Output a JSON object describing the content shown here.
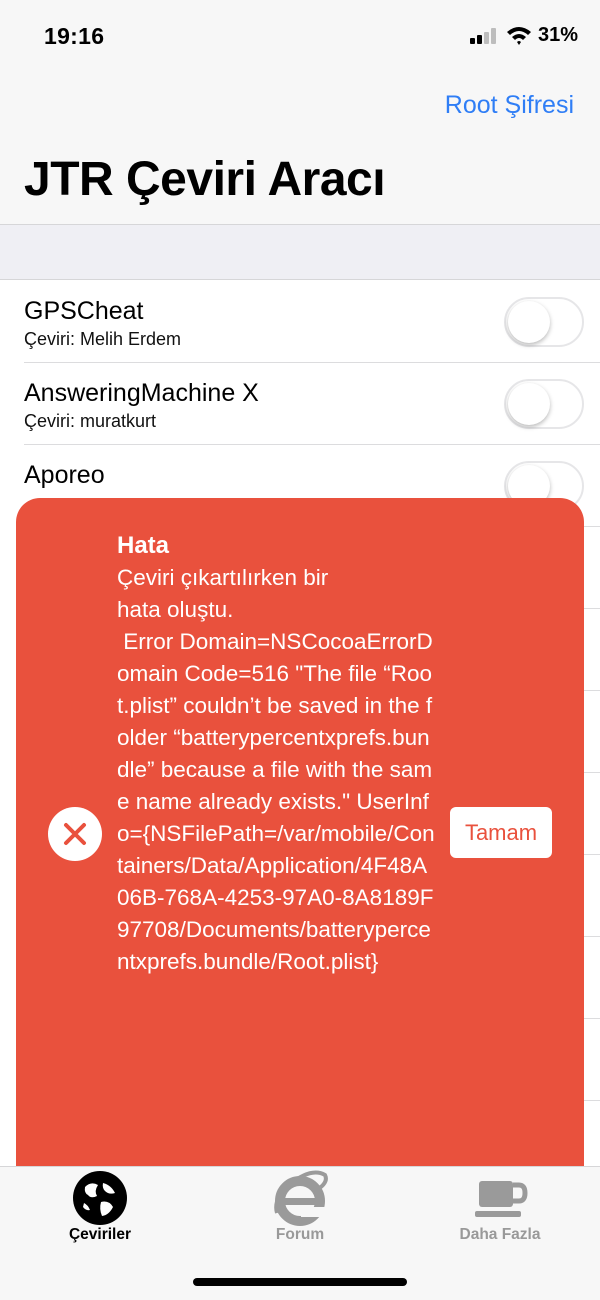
{
  "status_bar": {
    "time": "19:16",
    "battery": "31%"
  },
  "header": {
    "root_link": "Root Şifresi",
    "title": "JTR Çeviri Aracı"
  },
  "items": [
    {
      "name": "GPSCheat",
      "subtitle": "Çeviri: Melih Erdem",
      "enabled": false
    },
    {
      "name": "AnsweringMachine X",
      "subtitle": "Çeviri: muratkurt",
      "enabled": false
    },
    {
      "name": "Aporeo",
      "subtitle": "",
      "enabled": false
    }
  ],
  "error": {
    "title": "Hata",
    "message": "Çeviri çıkartılırken bir\nhata oluştu.\n Error Domain=NSCocoaErrorDomain Code=516 \"The file “Root.plist” couldn’t be saved in the folder “batterypercentxprefs.bundle” because a file with the same name already exists.\" UserInfo={NSFilePath=/var/mobile/Containers/Data/Application/4F48A06B-768A-4253-97A0-8A8189F97708/Documents/batterypercentxprefs.bundle/Root.plist}",
    "button": "Tamam"
  },
  "tabs": [
    {
      "label": "Çeviriler",
      "active": true
    },
    {
      "label": "Forum",
      "active": false
    },
    {
      "label": "Daha Fazla",
      "active": false
    }
  ],
  "colors": {
    "accent": "#2f7ef6",
    "error": "#e9513d",
    "inactive_tab": "#999999"
  }
}
